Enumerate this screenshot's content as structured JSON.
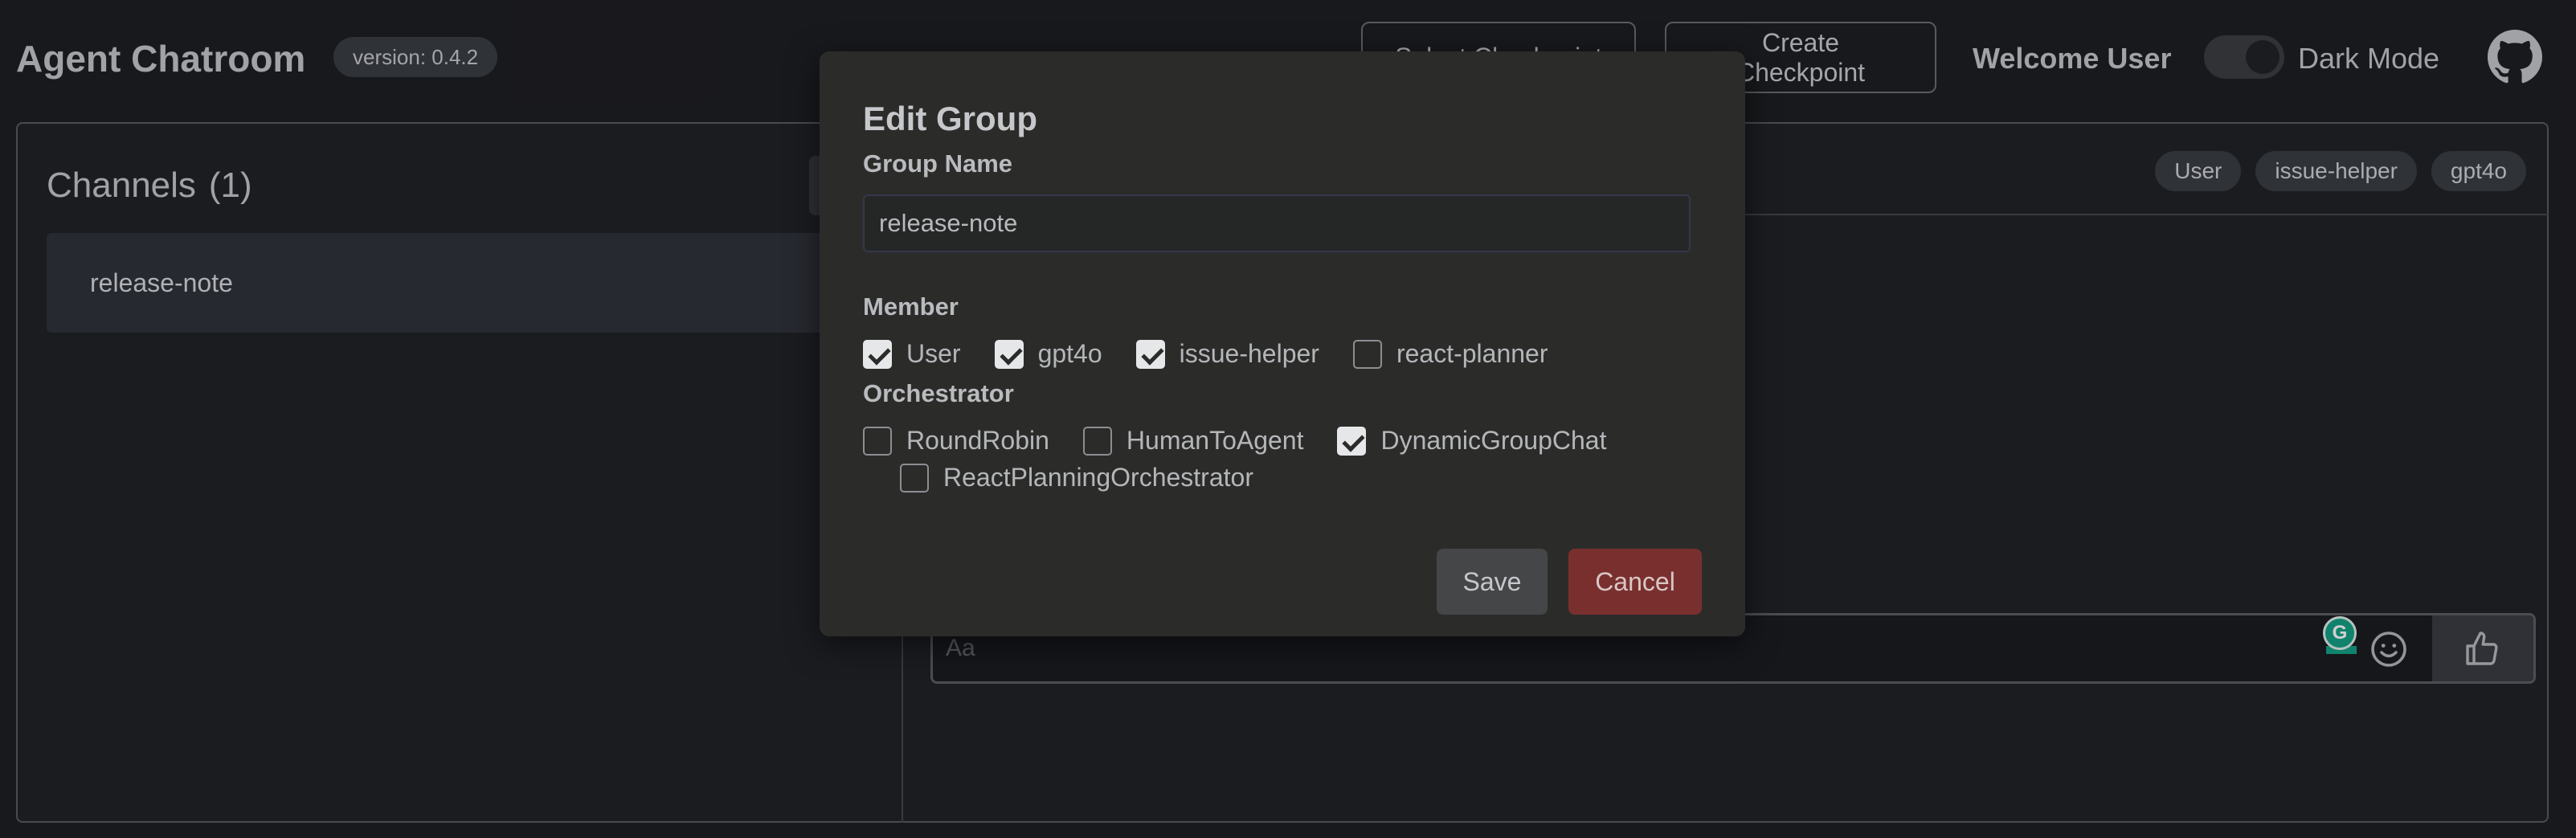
{
  "header": {
    "app_title": "Agent Chatroom",
    "version": "version: 0.4.2",
    "select_checkpoint_label": "Select Checkpoint",
    "create_checkpoint_label": "Create Checkpoint",
    "welcome": "Welcome User",
    "dark_mode_label": "Dark Mode",
    "dark_mode_on": true
  },
  "sidebar": {
    "title": "Channels",
    "count": "(1)",
    "channels": [
      {
        "label": "release-note"
      }
    ]
  },
  "chat": {
    "members": [
      "User",
      "issue-helper",
      "gpt4o"
    ],
    "input_placeholder": "Aa",
    "input_value": ""
  },
  "modal": {
    "title": "Edit Group",
    "group_name_label": "Group Name",
    "group_name_value": "release-note",
    "member_label": "Member",
    "members": [
      {
        "label": "User",
        "checked": true
      },
      {
        "label": "gpt4o",
        "checked": true
      },
      {
        "label": "issue-helper",
        "checked": true
      },
      {
        "label": "react-planner",
        "checked": false
      }
    ],
    "orchestrator_label": "Orchestrator",
    "orchestrators": [
      {
        "label": "RoundRobin",
        "checked": false
      },
      {
        "label": "HumanToAgent",
        "checked": false
      },
      {
        "label": "DynamicGroupChat",
        "checked": true
      },
      {
        "label": "ReactPlanningOrchestrator",
        "checked": false
      }
    ],
    "save_label": "Save",
    "cancel_label": "Cancel"
  },
  "colors": {
    "background": "#1e1f23",
    "modal_background": "#2b2c2a",
    "cancel_red": "#7a2f2f",
    "grammarly_green": "#15a086"
  },
  "icons": {
    "github": "github-icon",
    "emoji": "smiley-icon",
    "like": "thumbs-up-icon",
    "grammarly": "grammarly-icon"
  }
}
